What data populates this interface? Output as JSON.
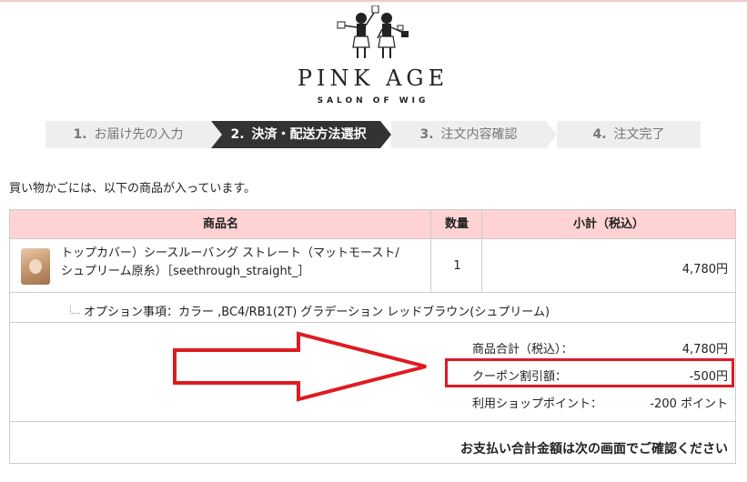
{
  "brand": {
    "name": "PINK AGE",
    "subtitle": "SALON OF WIG"
  },
  "steps": [
    {
      "num": "1.",
      "label": "お届け先の入力",
      "active": false
    },
    {
      "num": "2.",
      "label": "決済・配送方法選択",
      "active": true
    },
    {
      "num": "3.",
      "label": "注文内容確認",
      "active": false
    },
    {
      "num": "4.",
      "label": "注文完了",
      "active": false
    }
  ],
  "intro_text": "買い物かごには、以下の商品が入っています。",
  "table": {
    "headers": {
      "product": "商品名",
      "qty": "数量",
      "subtotal": "小計（税込）"
    },
    "item": {
      "name_line1": "トップカバー）シースルーバング ストレート（マットモースト/",
      "name_line2": "シュプリーム原糸）［seethrough_straight_］",
      "qty": "1",
      "price": "4,780円"
    },
    "option": "オプション事項：カラー ,BC4/RB1(2T) グラデーション レッドブラウン(シュプリーム)"
  },
  "summary": {
    "product_total_label": "商品合計（税込）：",
    "product_total_value": "4,780円",
    "coupon_label": "クーポン割引額：",
    "coupon_value": "-500円",
    "points_label": "利用ショップポイント：",
    "points_value": "-200 ポイント"
  },
  "total_note": "お支払い合計金額は次の画面でご確認ください",
  "colors": {
    "header_bg": "#ffd3d3",
    "highlight": "#e01a22",
    "active_step": "#333333"
  }
}
